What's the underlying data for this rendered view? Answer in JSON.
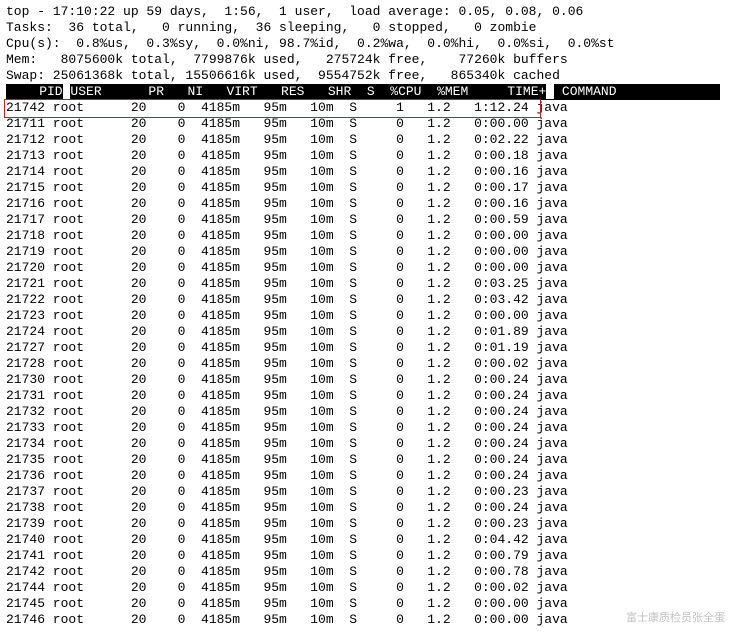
{
  "summary": {
    "line1": "top - 17:10:22 up 59 days,  1:56,  1 user,  load average: 0.05, 0.08, 0.06",
    "line2": "Tasks:  36 total,   0 running,  36 sleeping,   0 stopped,   0 zombie",
    "line3": "Cpu(s):  0.8%us,  0.3%sy,  0.0%ni, 98.7%id,  0.2%wa,  0.0%hi,  0.0%si,  0.0%st",
    "line4": "Mem:   8075600k total,  7799876k used,   275724k free,    77260k buffers",
    "line5": "Swap: 25061368k total, 15506616k used,  9554752k free,   865340k cached"
  },
  "columns": {
    "pid": "PID",
    "user": "USER",
    "pr": "PR",
    "ni": "NI",
    "virt": "VIRT",
    "res": "RES",
    "shr": "SHR",
    "s": "S",
    "cpu": "%CPU",
    "mem": "%MEM",
    "time": "TIME+",
    "command": "COMMAND"
  },
  "processes": [
    {
      "pid": "21742",
      "user": "root",
      "pr": "20",
      "ni": "0",
      "virt": "4185m",
      "res": "95m",
      "shr": "10m",
      "s": "S",
      "cpu": "1",
      "mem": "1.2",
      "time": "1:12.24",
      "command": "java",
      "highlight": true
    },
    {
      "pid": "21711",
      "user": "root",
      "pr": "20",
      "ni": "0",
      "virt": "4185m",
      "res": "95m",
      "shr": "10m",
      "s": "S",
      "cpu": "0",
      "mem": "1.2",
      "time": "0:00.00",
      "command": "java"
    },
    {
      "pid": "21712",
      "user": "root",
      "pr": "20",
      "ni": "0",
      "virt": "4185m",
      "res": "95m",
      "shr": "10m",
      "s": "S",
      "cpu": "0",
      "mem": "1.2",
      "time": "0:02.22",
      "command": "java"
    },
    {
      "pid": "21713",
      "user": "root",
      "pr": "20",
      "ni": "0",
      "virt": "4185m",
      "res": "95m",
      "shr": "10m",
      "s": "S",
      "cpu": "0",
      "mem": "1.2",
      "time": "0:00.18",
      "command": "java"
    },
    {
      "pid": "21714",
      "user": "root",
      "pr": "20",
      "ni": "0",
      "virt": "4185m",
      "res": "95m",
      "shr": "10m",
      "s": "S",
      "cpu": "0",
      "mem": "1.2",
      "time": "0:00.16",
      "command": "java"
    },
    {
      "pid": "21715",
      "user": "root",
      "pr": "20",
      "ni": "0",
      "virt": "4185m",
      "res": "95m",
      "shr": "10m",
      "s": "S",
      "cpu": "0",
      "mem": "1.2",
      "time": "0:00.17",
      "command": "java"
    },
    {
      "pid": "21716",
      "user": "root",
      "pr": "20",
      "ni": "0",
      "virt": "4185m",
      "res": "95m",
      "shr": "10m",
      "s": "S",
      "cpu": "0",
      "mem": "1.2",
      "time": "0:00.16",
      "command": "java"
    },
    {
      "pid": "21717",
      "user": "root",
      "pr": "20",
      "ni": "0",
      "virt": "4185m",
      "res": "95m",
      "shr": "10m",
      "s": "S",
      "cpu": "0",
      "mem": "1.2",
      "time": "0:00.59",
      "command": "java"
    },
    {
      "pid": "21718",
      "user": "root",
      "pr": "20",
      "ni": "0",
      "virt": "4185m",
      "res": "95m",
      "shr": "10m",
      "s": "S",
      "cpu": "0",
      "mem": "1.2",
      "time": "0:00.00",
      "command": "java"
    },
    {
      "pid": "21719",
      "user": "root",
      "pr": "20",
      "ni": "0",
      "virt": "4185m",
      "res": "95m",
      "shr": "10m",
      "s": "S",
      "cpu": "0",
      "mem": "1.2",
      "time": "0:00.00",
      "command": "java"
    },
    {
      "pid": "21720",
      "user": "root",
      "pr": "20",
      "ni": "0",
      "virt": "4185m",
      "res": "95m",
      "shr": "10m",
      "s": "S",
      "cpu": "0",
      "mem": "1.2",
      "time": "0:00.00",
      "command": "java"
    },
    {
      "pid": "21721",
      "user": "root",
      "pr": "20",
      "ni": "0",
      "virt": "4185m",
      "res": "95m",
      "shr": "10m",
      "s": "S",
      "cpu": "0",
      "mem": "1.2",
      "time": "0:03.25",
      "command": "java"
    },
    {
      "pid": "21722",
      "user": "root",
      "pr": "20",
      "ni": "0",
      "virt": "4185m",
      "res": "95m",
      "shr": "10m",
      "s": "S",
      "cpu": "0",
      "mem": "1.2",
      "time": "0:03.42",
      "command": "java"
    },
    {
      "pid": "21723",
      "user": "root",
      "pr": "20",
      "ni": "0",
      "virt": "4185m",
      "res": "95m",
      "shr": "10m",
      "s": "S",
      "cpu": "0",
      "mem": "1.2",
      "time": "0:00.00",
      "command": "java"
    },
    {
      "pid": "21724",
      "user": "root",
      "pr": "20",
      "ni": "0",
      "virt": "4185m",
      "res": "95m",
      "shr": "10m",
      "s": "S",
      "cpu": "0",
      "mem": "1.2",
      "time": "0:01.89",
      "command": "java"
    },
    {
      "pid": "21727",
      "user": "root",
      "pr": "20",
      "ni": "0",
      "virt": "4185m",
      "res": "95m",
      "shr": "10m",
      "s": "S",
      "cpu": "0",
      "mem": "1.2",
      "time": "0:01.19",
      "command": "java"
    },
    {
      "pid": "21728",
      "user": "root",
      "pr": "20",
      "ni": "0",
      "virt": "4185m",
      "res": "95m",
      "shr": "10m",
      "s": "S",
      "cpu": "0",
      "mem": "1.2",
      "time": "0:00.02",
      "command": "java"
    },
    {
      "pid": "21730",
      "user": "root",
      "pr": "20",
      "ni": "0",
      "virt": "4185m",
      "res": "95m",
      "shr": "10m",
      "s": "S",
      "cpu": "0",
      "mem": "1.2",
      "time": "0:00.24",
      "command": "java"
    },
    {
      "pid": "21731",
      "user": "root",
      "pr": "20",
      "ni": "0",
      "virt": "4185m",
      "res": "95m",
      "shr": "10m",
      "s": "S",
      "cpu": "0",
      "mem": "1.2",
      "time": "0:00.24",
      "command": "java"
    },
    {
      "pid": "21732",
      "user": "root",
      "pr": "20",
      "ni": "0",
      "virt": "4185m",
      "res": "95m",
      "shr": "10m",
      "s": "S",
      "cpu": "0",
      "mem": "1.2",
      "time": "0:00.24",
      "command": "java"
    },
    {
      "pid": "21733",
      "user": "root",
      "pr": "20",
      "ni": "0",
      "virt": "4185m",
      "res": "95m",
      "shr": "10m",
      "s": "S",
      "cpu": "0",
      "mem": "1.2",
      "time": "0:00.24",
      "command": "java"
    },
    {
      "pid": "21734",
      "user": "root",
      "pr": "20",
      "ni": "0",
      "virt": "4185m",
      "res": "95m",
      "shr": "10m",
      "s": "S",
      "cpu": "0",
      "mem": "1.2",
      "time": "0:00.24",
      "command": "java"
    },
    {
      "pid": "21735",
      "user": "root",
      "pr": "20",
      "ni": "0",
      "virt": "4185m",
      "res": "95m",
      "shr": "10m",
      "s": "S",
      "cpu": "0",
      "mem": "1.2",
      "time": "0:00.24",
      "command": "java"
    },
    {
      "pid": "21736",
      "user": "root",
      "pr": "20",
      "ni": "0",
      "virt": "4185m",
      "res": "95m",
      "shr": "10m",
      "s": "S",
      "cpu": "0",
      "mem": "1.2",
      "time": "0:00.24",
      "command": "java"
    },
    {
      "pid": "21737",
      "user": "root",
      "pr": "20",
      "ni": "0",
      "virt": "4185m",
      "res": "95m",
      "shr": "10m",
      "s": "S",
      "cpu": "0",
      "mem": "1.2",
      "time": "0:00.23",
      "command": "java"
    },
    {
      "pid": "21738",
      "user": "root",
      "pr": "20",
      "ni": "0",
      "virt": "4185m",
      "res": "95m",
      "shr": "10m",
      "s": "S",
      "cpu": "0",
      "mem": "1.2",
      "time": "0:00.24",
      "command": "java"
    },
    {
      "pid": "21739",
      "user": "root",
      "pr": "20",
      "ni": "0",
      "virt": "4185m",
      "res": "95m",
      "shr": "10m",
      "s": "S",
      "cpu": "0",
      "mem": "1.2",
      "time": "0:00.23",
      "command": "java"
    },
    {
      "pid": "21740",
      "user": "root",
      "pr": "20",
      "ni": "0",
      "virt": "4185m",
      "res": "95m",
      "shr": "10m",
      "s": "S",
      "cpu": "0",
      "mem": "1.2",
      "time": "0:04.42",
      "command": "java"
    },
    {
      "pid": "21741",
      "user": "root",
      "pr": "20",
      "ni": "0",
      "virt": "4185m",
      "res": "95m",
      "shr": "10m",
      "s": "S",
      "cpu": "0",
      "mem": "1.2",
      "time": "0:00.79",
      "command": "java"
    },
    {
      "pid": "21742",
      "user": "root",
      "pr": "20",
      "ni": "0",
      "virt": "4185m",
      "res": "95m",
      "shr": "10m",
      "s": "S",
      "cpu": "0",
      "mem": "1.2",
      "time": "0:00.78",
      "command": "java"
    },
    {
      "pid": "21744",
      "user": "root",
      "pr": "20",
      "ni": "0",
      "virt": "4185m",
      "res": "95m",
      "shr": "10m",
      "s": "S",
      "cpu": "0",
      "mem": "1.2",
      "time": "0:00.02",
      "command": "java"
    },
    {
      "pid": "21745",
      "user": "root",
      "pr": "20",
      "ni": "0",
      "virt": "4185m",
      "res": "95m",
      "shr": "10m",
      "s": "S",
      "cpu": "0",
      "mem": "1.2",
      "time": "0:00.00",
      "command": "java"
    },
    {
      "pid": "21746",
      "user": "root",
      "pr": "20",
      "ni": "0",
      "virt": "4185m",
      "res": "95m",
      "shr": "10m",
      "s": "S",
      "cpu": "0",
      "mem": "1.2",
      "time": "0:00.00",
      "command": "java"
    }
  ],
  "watermark": "富士康质检员张全蛋"
}
